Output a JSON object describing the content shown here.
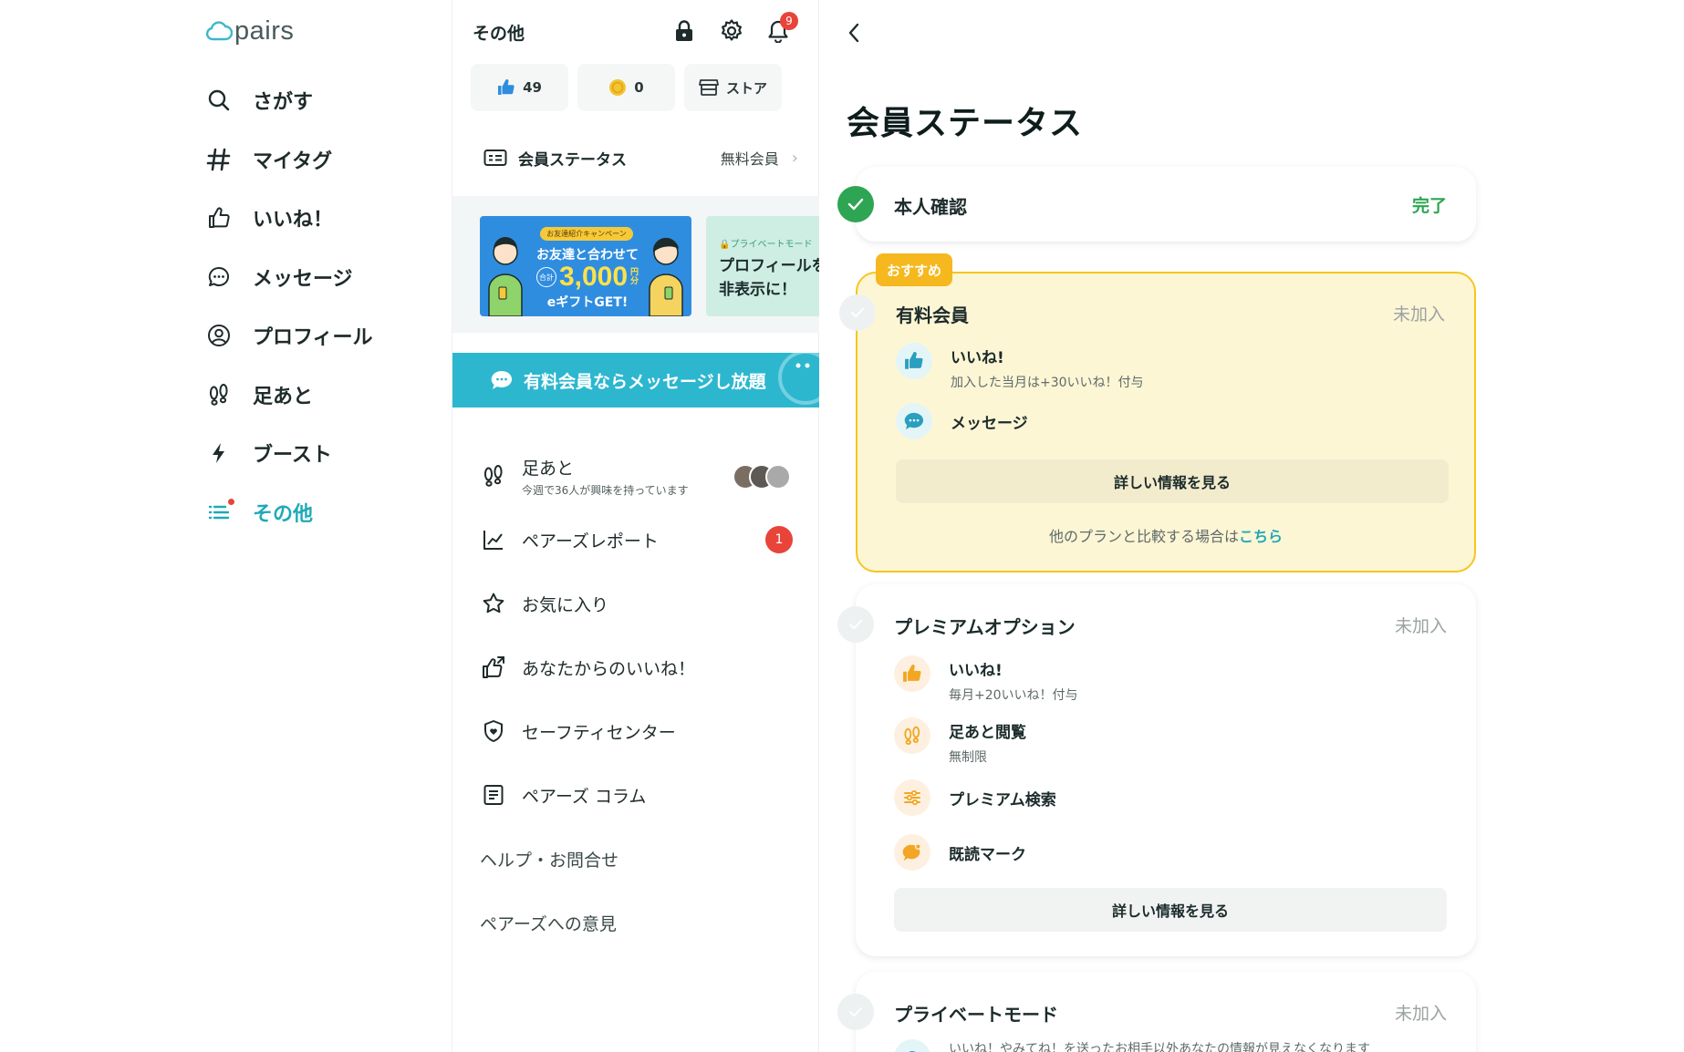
{
  "sidebar": {
    "logo_text": "pairs",
    "items": [
      {
        "label": "さがす",
        "icon": "search-icon"
      },
      {
        "label": "マイタグ",
        "icon": "hashtag-icon"
      },
      {
        "label": "いいね！",
        "icon": "thumbs-up-icon"
      },
      {
        "label": "メッセージ",
        "icon": "message-icon"
      },
      {
        "label": "プロフィール",
        "icon": "profile-icon"
      },
      {
        "label": "足あと",
        "icon": "footprints-icon"
      },
      {
        "label": "ブースト",
        "icon": "lightning-icon"
      },
      {
        "label": "その他",
        "icon": "list-icon",
        "active": true
      }
    ]
  },
  "middle": {
    "title": "その他",
    "bell_badge": "9",
    "stats": {
      "likes": "49",
      "coins": "0",
      "store": "ストア"
    },
    "member_status": {
      "label": "会員ステータス",
      "value": "無料会員"
    },
    "banner1": {
      "tag": "お友達紹介キャンペーン",
      "line1": "お友達と合わせて",
      "total": "合計",
      "amount": "3,000",
      "unit_top": "円",
      "unit_bottom": "分",
      "line3": "eギフトGET!"
    },
    "banner2": {
      "tag": "プライベートモード",
      "line1": "プロフィールを",
      "line2": "非表示に！"
    },
    "promo": "有料会員ならメッセージし放題",
    "menu": {
      "footprints": {
        "label": "足あと",
        "sub": "今週で36人が興味を持っています"
      },
      "report": {
        "label": "ペアーズレポート",
        "badge": "1"
      },
      "favorites": {
        "label": "お気に入り"
      },
      "likes_from_you": {
        "label": "あなたからのいいね！"
      },
      "safety": {
        "label": "セーフティセンター"
      },
      "column": {
        "label": "ペアーズ コラム"
      },
      "help": {
        "label": "ヘルプ・お問合せ"
      },
      "feedback": {
        "label": "ペアーズへの意見"
      }
    }
  },
  "right": {
    "title": "会員ステータス",
    "identity": {
      "title": "本人確認",
      "status": "完了"
    },
    "paid": {
      "tag": "おすすめ",
      "title": "有料会員",
      "status": "未加入",
      "features": [
        {
          "title": "いいね!",
          "sub": "加入した当月は+30いいね！付与"
        },
        {
          "title": "メッセージ",
          "sub": ""
        }
      ],
      "detail_button": "詳しい情報を見る",
      "compare_text": "他のプランと比較する場合は",
      "compare_link": "こちら"
    },
    "premium": {
      "title": "プレミアムオプション",
      "status": "未加入",
      "features": [
        {
          "title": "いいね!",
          "sub": "毎月+20いいね！付与"
        },
        {
          "title": "足あと閲覧",
          "sub": "無制限"
        },
        {
          "title": "プレミアム検索",
          "sub": ""
        },
        {
          "title": "既読マーク",
          "sub": ""
        }
      ],
      "detail_button": "詳しい情報を見る"
    },
    "private": {
      "title": "プライベートモード",
      "status": "未加入",
      "desc": "いいね！やみてね！を送ったお相手以外あなたの情報が見えなくなります"
    }
  },
  "colors": {
    "accent": "#1fa9b8",
    "success": "#2ea553",
    "recommend": "#f5c61e",
    "badge": "#e8443a"
  }
}
